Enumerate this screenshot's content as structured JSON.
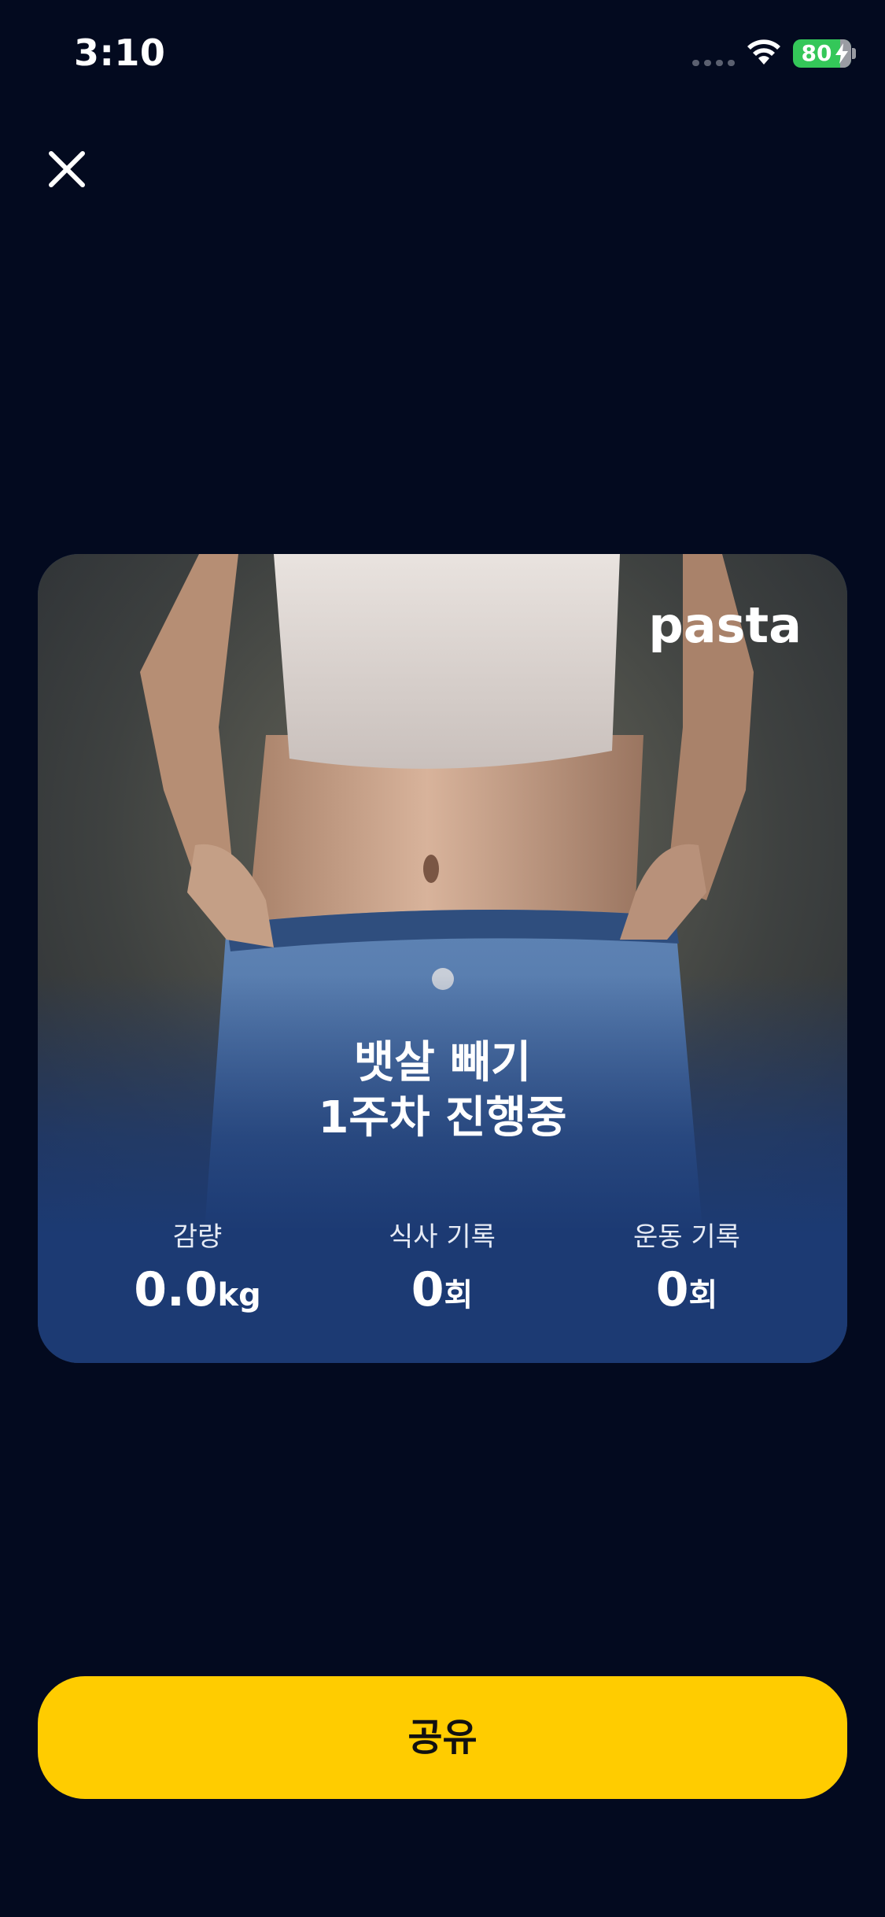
{
  "status_bar": {
    "time": "3:10",
    "battery_level": "80",
    "icons": [
      "signal-icon",
      "wifi-icon",
      "battery-icon",
      "charging-bolt-icon"
    ]
  },
  "header": {
    "close_icon": "close-icon"
  },
  "card": {
    "logo_text": "pasta",
    "image_description_icon": "photo",
    "title_line1": "뱃살 빼기",
    "title_line2": "1주차 진행중",
    "stats": [
      {
        "label": "감량",
        "value": "0.0",
        "unit": "kg"
      },
      {
        "label": "식사 기록",
        "value": "0",
        "unit": "회"
      },
      {
        "label": "운동 기록",
        "value": "0",
        "unit": "회"
      }
    ]
  },
  "share_button": {
    "label": "공유"
  },
  "colors": {
    "background": "#030a1f",
    "card_blue": "#1c3a73",
    "accent_yellow": "#ffcc00",
    "battery_green": "#34c759"
  }
}
